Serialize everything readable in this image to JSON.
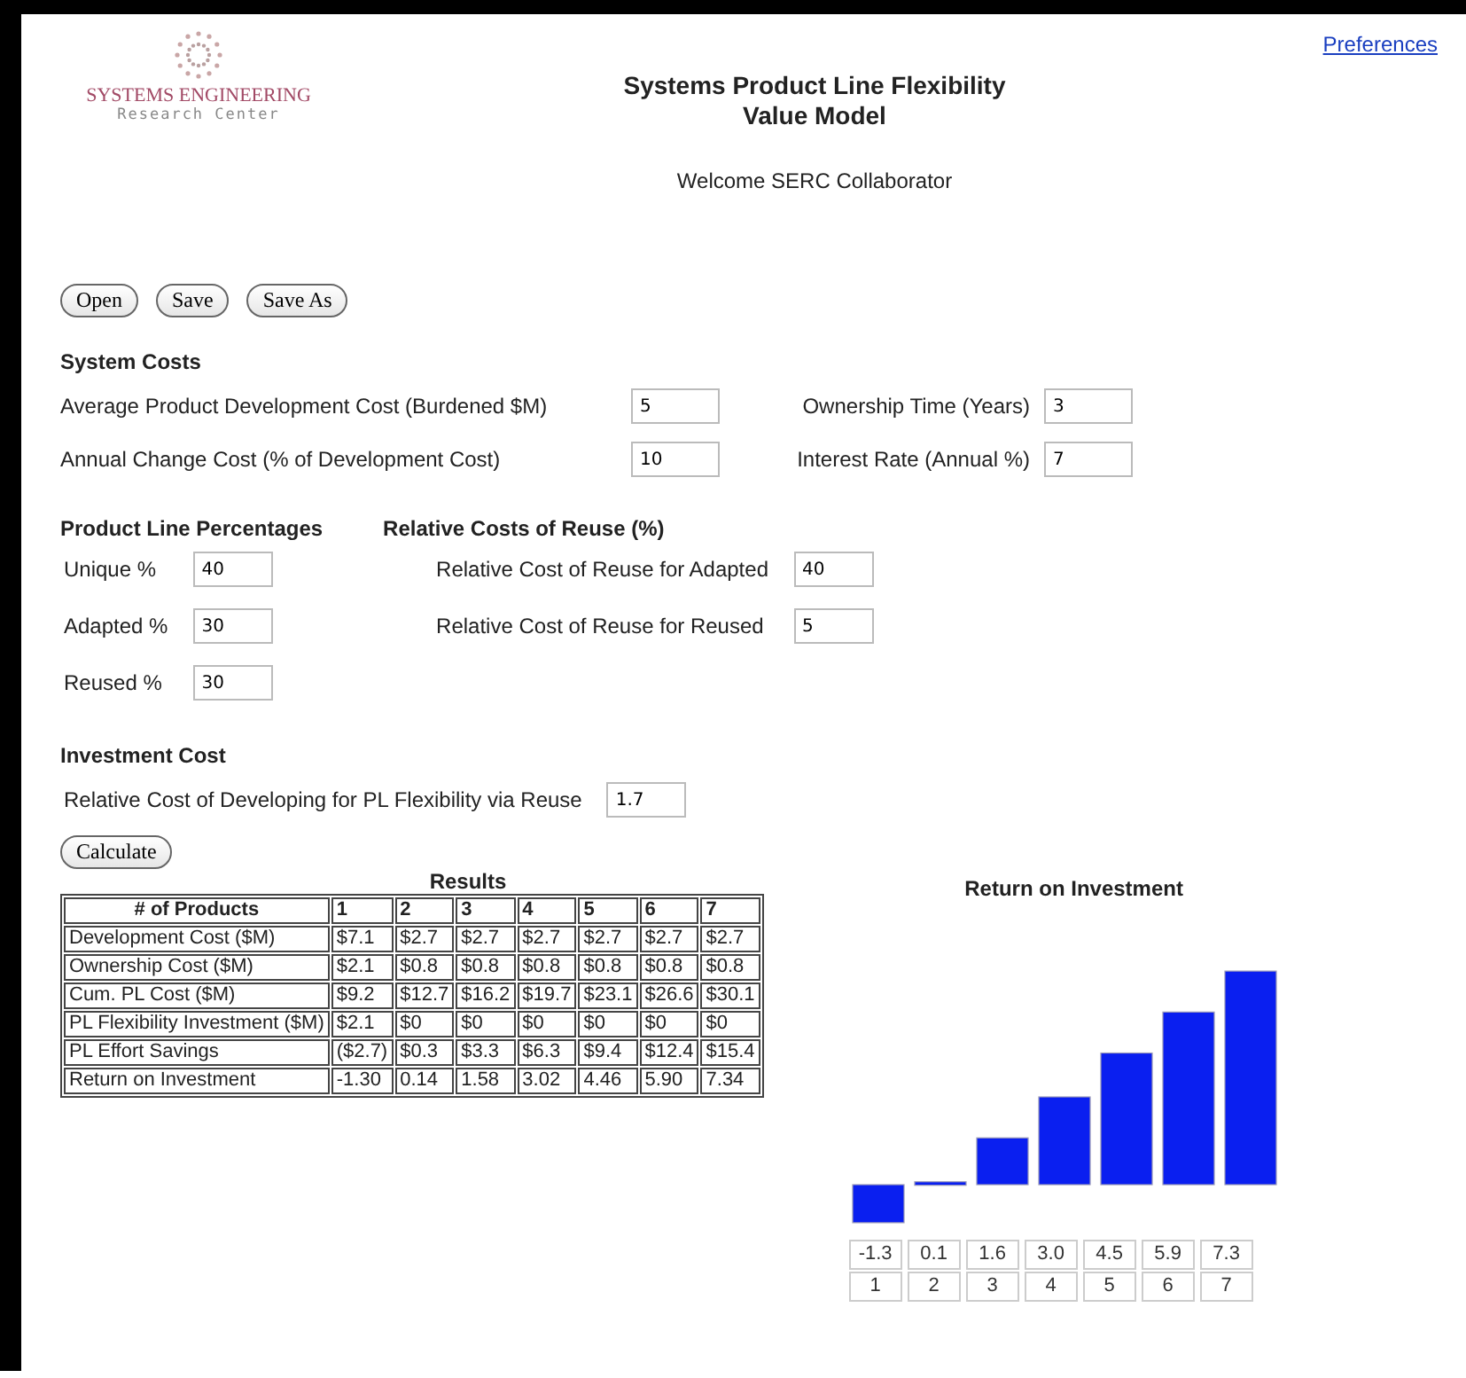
{
  "logo": {
    "line_1": "SYSTEMS ENGINEERING",
    "line_2": "Research Center"
  },
  "title": [
    "Systems Product Line Flexibility",
    "Value Model"
  ],
  "welcome": "Welcome SERC Collaborator",
  "preferences_link": "Preferences",
  "buttons": [
    "Open",
    "Save",
    "Save As"
  ],
  "system_costs": {
    "heading": "System Costs",
    "fields": [
      {
        "label": "Average Product Development Cost (Burdened $M)",
        "value": "5"
      },
      {
        "label": "Ownership Time (Years)",
        "value": "3"
      },
      {
        "label": "Annual Change Cost (% of Development Cost)",
        "value": "10"
      },
      {
        "label": "Interest Rate (Annual %)",
        "value": "7"
      }
    ]
  },
  "product_line_percentages": {
    "heading": "Product Line Percentages",
    "fields": [
      {
        "label": "Unique %",
        "value": "40"
      },
      {
        "label": "Adapted %",
        "value": "30"
      },
      {
        "label": "Reused %",
        "value": "30"
      }
    ]
  },
  "relative_costs_of_reuse": {
    "heading": "Relative Costs of Reuse (%)",
    "fields": [
      {
        "label": "Relative Cost of Reuse for Adapted",
        "value": "40"
      },
      {
        "label": "Relative Cost of Reuse for Reused",
        "value": "5"
      }
    ]
  },
  "investment_cost": {
    "heading": "Investment Cost",
    "fields": [
      {
        "label": "Relative Cost of Developing for PL Flexibility via Reuse",
        "value": "1.7"
      }
    ]
  },
  "calculate_button": "Calculate",
  "results": {
    "title": "Results",
    "columns": [
      "# of Products",
      "1",
      "2",
      "3",
      "4",
      "5",
      "6",
      "7"
    ],
    "rows": [
      [
        "Development Cost ($M)",
        "$7.1",
        "$2.7",
        "$2.7",
        "$2.7",
        "$2.7",
        "$2.7",
        "$2.7"
      ],
      [
        "Ownership Cost ($M)",
        "$2.1",
        "$0.8",
        "$0.8",
        "$0.8",
        "$0.8",
        "$0.8",
        "$0.8"
      ],
      [
        "Cum. PL Cost ($M)",
        "$9.2",
        "$12.7",
        "$16.2",
        "$19.7",
        "$23.1",
        "$26.6",
        "$30.1"
      ],
      [
        "PL Flexibility Investment ($M)",
        "$2.1",
        "$0",
        "$0",
        "$0",
        "$0",
        "$0",
        "$0"
      ],
      [
        "PL Effort Savings",
        "($2.7)",
        "$0.3",
        "$3.3",
        "$6.3",
        "$9.4",
        "$12.4",
        "$15.4"
      ],
      [
        "Return on Investment",
        "-1.30",
        "0.14",
        "1.58",
        "3.02",
        "4.46",
        "5.90",
        "7.34"
      ]
    ]
  },
  "roi_chart": {
    "chart_data": {
      "type": "bar",
      "title": "Return on Investment",
      "categories": [
        "1",
        "2",
        "3",
        "4",
        "5",
        "6",
        "7"
      ],
      "values": [
        -1.3,
        0.1,
        1.6,
        3.0,
        4.5,
        5.9,
        7.3
      ],
      "value_labels": [
        "-1.3",
        "0.1",
        "1.6",
        "3.0",
        "4.5",
        "5.9",
        "7.3"
      ]
    }
  }
}
